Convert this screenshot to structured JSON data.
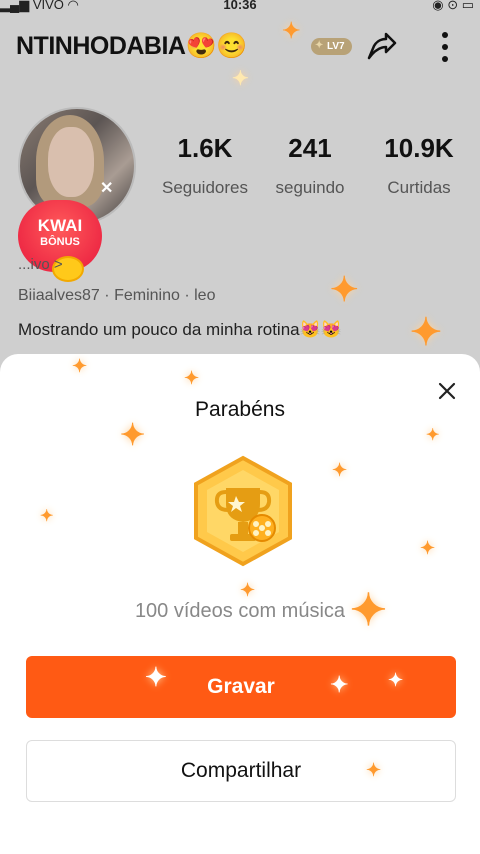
{
  "status_bar": {
    "carrier": "VIVO",
    "time": "10:36"
  },
  "profile": {
    "username": "NTINHODABIA😍😊",
    "level_badge": "LV7",
    "stats": [
      {
        "value": "1.6K",
        "label": "Seguidores"
      },
      {
        "value": "241",
        "label": "seguindo"
      },
      {
        "value": "10.9K",
        "label": "Curtidas"
      }
    ],
    "kwai_bonus": {
      "line1": "KWAI",
      "line2": "BÔNUS"
    },
    "partial_meta": "...ivo >",
    "handle": "Biiaalves87",
    "gender": "Feminino",
    "extra": "leo",
    "bio": "Mostrando um pouco da minha rotina😻😻"
  },
  "sheet": {
    "title": "Parabéns",
    "achievement": "100 vídeos com música",
    "primary_button": "Gravar",
    "secondary_button": "Compartilhar"
  },
  "colors": {
    "accent": "#ff5a14",
    "badge": "#b8a277",
    "sparkle": "#ff9a2e"
  }
}
